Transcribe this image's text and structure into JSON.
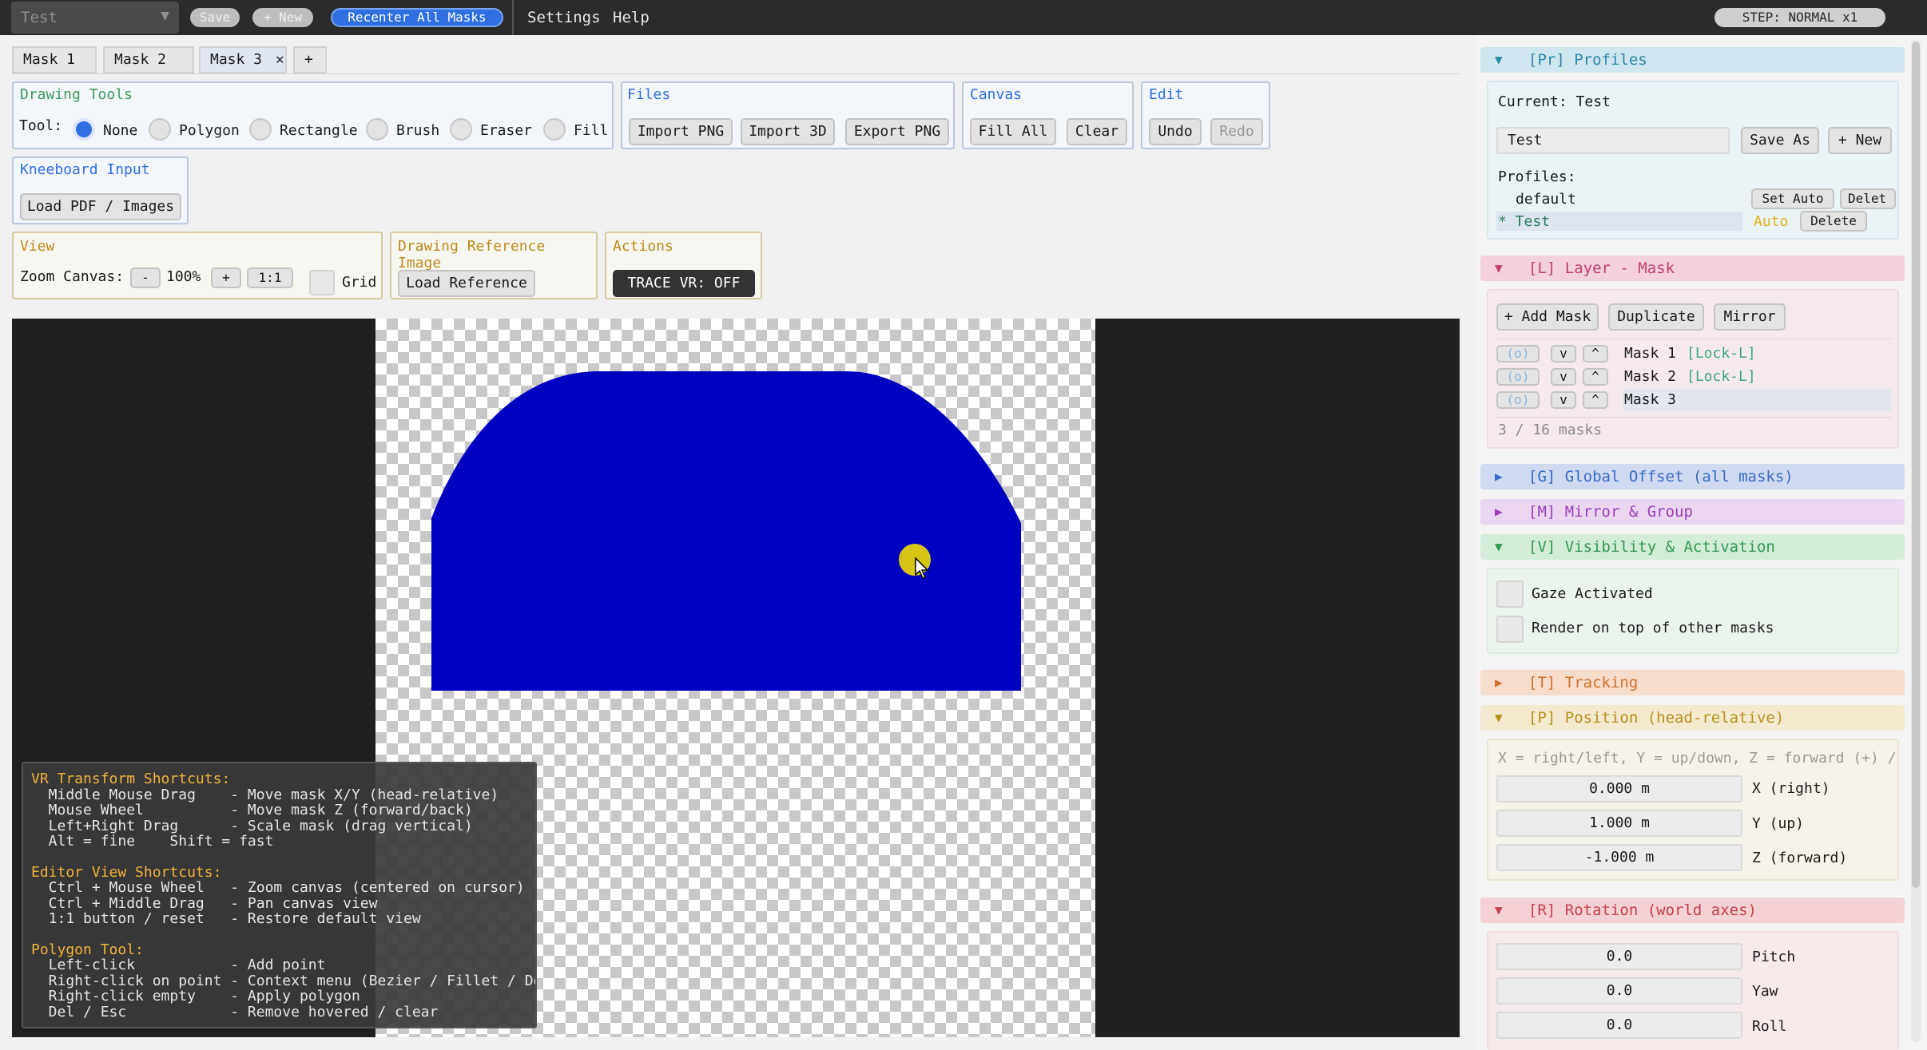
{
  "menubar": {
    "profile_select": "Test",
    "save": "Save",
    "new": "+ New",
    "recenter": "Recenter All Masks",
    "settings": "Settings",
    "help": "Help",
    "step": "STEP: NORMAL  x1"
  },
  "tabs": [
    {
      "label": "Mask 1"
    },
    {
      "label": "Mask 2"
    },
    {
      "label": "Mask 3",
      "close": "✕"
    },
    {
      "label": "+"
    }
  ],
  "drawing_tools": {
    "title": "Drawing Tools",
    "tool_label": "Tool:",
    "options": [
      "None",
      "Polygon",
      "Rectangle",
      "Brush",
      "Eraser",
      "Fill"
    ],
    "selected": "None"
  },
  "files": {
    "title": "Files",
    "import_png": "Import PNG",
    "import_3d": "Import 3D",
    "export_png": "Export PNG"
  },
  "canvas_group": {
    "title": "Canvas",
    "fill_all": "Fill All",
    "clear": "Clear"
  },
  "edit": {
    "title": "Edit",
    "undo": "Undo",
    "redo": "Redo"
  },
  "kneeboard": {
    "title": "Kneeboard Input",
    "load": "Load PDF / Images"
  },
  "view": {
    "title": "View",
    "zoom_label": "Zoom Canvas:",
    "minus": "-",
    "zoom": "100%",
    "plus": "+",
    "one_to_one": "1:1",
    "grid": "Grid"
  },
  "reference": {
    "title": "Drawing Reference Image",
    "load": "Load Reference"
  },
  "actions": {
    "title": "Actions",
    "trace": "TRACE VR: OFF"
  },
  "colors": {
    "mask_fill": "#0000c0",
    "accent_blue": "#2f6fe0",
    "cursor_dot": "#d6c516",
    "auto_label": "#e8b21a",
    "lock_label": "#3aa87a"
  },
  "shortcuts": {
    "vr_title": "VR Transform Shortcuts:",
    "vr_lines": [
      "  Middle Mouse Drag    - Move mask X/Y (head-relative)",
      "  Mouse Wheel          - Move mask Z (forward/back)",
      "  Left+Right Drag      - Scale mask (drag vertical)",
      "  Alt = fine    Shift = fast"
    ],
    "editor_title": "Editor View Shortcuts:",
    "editor_lines": [
      "  Ctrl + Mouse Wheel   - Zoom canvas (centered on cursor)",
      "  Ctrl + Middle Drag   - Pan canvas view",
      "  1:1 button / reset   - Restore default view"
    ],
    "poly_title": "Polygon Tool:",
    "poly_lines": [
      "  Left-click           - Add point",
      "  Right-click on point - Context menu (Bezier / Fillet / Delete)",
      "  Right-click empty    - Apply polygon",
      "  Del / Esc            - Remove hovered / clear"
    ]
  },
  "panel": {
    "profiles": {
      "head": "[Pr] Profiles",
      "current": "Current: Test",
      "name_value": "Test",
      "save_as": "Save As",
      "new": "+ New",
      "list_label": "Profiles:",
      "items": [
        {
          "name": "default",
          "action1": "Set Auto",
          "action2": "Delet"
        },
        {
          "name": "* Test",
          "auto": "Auto",
          "action2": "Delete"
        }
      ]
    },
    "layer": {
      "head": "[L] Layer - Mask",
      "add": "+ Add Mask",
      "duplicate": "Duplicate",
      "mirror": "Mirror",
      "masks": [
        {
          "vis": "(o)",
          "down": "v",
          "up": "^",
          "name": "Mask 1",
          "lock": "[Lock-L]"
        },
        {
          "vis": "(o)",
          "down": "v",
          "up": "^",
          "name": "Mask 2",
          "lock": "[Lock-L]"
        },
        {
          "vis": "(o)",
          "down": "v",
          "up": "^",
          "name": "Mask 3",
          "lock": ""
        }
      ],
      "count": "3 / 16 masks"
    },
    "global_offset": "[G] Global Offset (all masks)",
    "mirror_group": "[M] Mirror & Group",
    "visibility": {
      "head": "[V] Visibility & Activation",
      "gaze": "Gaze Activated",
      "render_top": "Render on top of other masks"
    },
    "tracking": "[T] Tracking",
    "position": {
      "head": "[P] Position (head-relative)",
      "hint": "X = right/left, Y = up/down, Z = forward (+) / b",
      "x_value": "0.000 m",
      "x_label": "X (right)",
      "y_value": "1.000 m",
      "y_label": "Y (up)",
      "z_value": "-1.000 m",
      "z_label": "Z (forward)"
    },
    "rotation": {
      "head": "[R] Rotation (world axes)",
      "pitch_value": "0.0",
      "pitch_label": "Pitch",
      "yaw_value": "0.0",
      "yaw_label": "Yaw",
      "roll_value": "0.0",
      "roll_label": "Roll"
    }
  }
}
